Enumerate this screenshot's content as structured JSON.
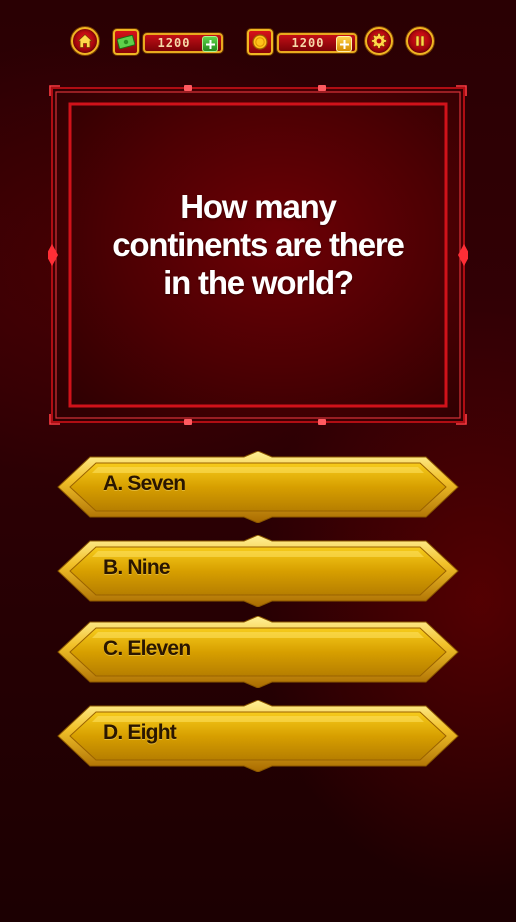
{
  "topbar": {
    "home_icon": "home-icon",
    "cash": {
      "icon": "cash-icon",
      "value": "1200",
      "add_icon": "plus-icon"
    },
    "coins": {
      "icon": "coin-icon",
      "value": "1200",
      "add_icon": "plus-icon"
    },
    "settings_icon": "gear-icon",
    "pause_icon": "pause-icon"
  },
  "question": {
    "text": "How many continents are there in the world?"
  },
  "answers": [
    {
      "label": "A. Seven"
    },
    {
      "label": "B. Nine"
    },
    {
      "label": "C. Eleven"
    },
    {
      "label": "D. Eight"
    }
  ],
  "colors": {
    "accent_gold": "#f0b623",
    "answer_gold": "#d9a400",
    "board_red": "#5e0003",
    "frame_red": "#e0151e"
  }
}
